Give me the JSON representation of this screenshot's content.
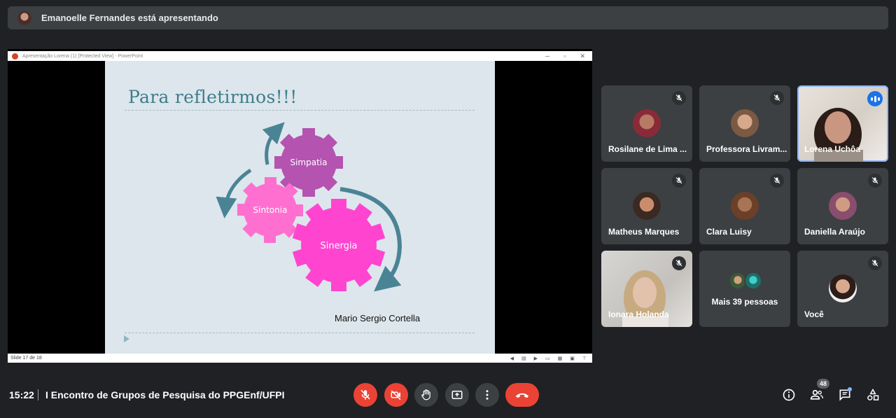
{
  "banner": {
    "presenter_text": "Emanoelle Fernandes está apresentando"
  },
  "presentation": {
    "window_title": "Apresentação Lorena (1) [Protected View] - PowerPoint",
    "status_slide": "Slide 17 de 18",
    "slide": {
      "title": "Para refletirmos!!!",
      "gears": [
        "Simpatia",
        "Sintonia",
        "Sinergia"
      ],
      "author": "Mario Sergio Cortella"
    }
  },
  "participants": [
    {
      "name": "Rosilane de Lima ...",
      "muted": true
    },
    {
      "name": "Professora Livram...",
      "muted": true
    },
    {
      "name": "Lorena Uchôa",
      "speaking": true
    },
    {
      "name": "Matheus Marques",
      "muted": true
    },
    {
      "name": "Clara Luisy",
      "muted": true
    },
    {
      "name": "Daniella Araújo",
      "muted": true
    },
    {
      "name": "Ionara Holanda",
      "muted": true
    },
    {
      "name": "Mais 39 pessoas"
    },
    {
      "name": "Você",
      "muted": true
    }
  ],
  "bottom_bar": {
    "time": "15:22",
    "meeting_title": "I Encontro de Grupos de Pesquisa do PPGEnf/UFPI",
    "people_count": "48"
  },
  "colors": {
    "accent": "#8ab4f8",
    "danger": "#ea4335",
    "surface": "#3c4043",
    "background": "#202124",
    "gear_pink": "#ff5fd1",
    "gear_purple": "#b453b0",
    "arrow_teal": "#4a8494"
  },
  "icons": [
    "mic-off-icon",
    "camera-off-icon",
    "raise-hand-icon",
    "present-icon",
    "more-options-icon",
    "end-call-icon",
    "info-icon",
    "people-icon",
    "chat-icon",
    "activities-icon"
  ]
}
